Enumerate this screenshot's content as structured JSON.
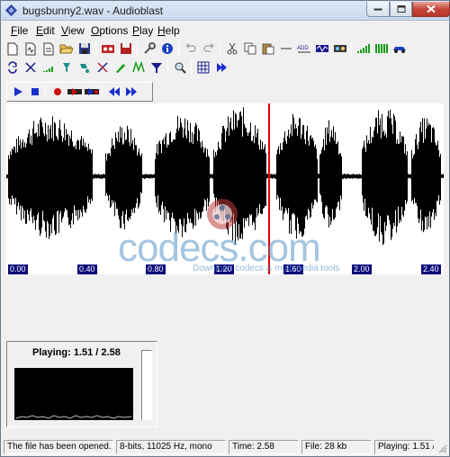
{
  "window": {
    "title": "bugsbunny2.wav - Audioblast"
  },
  "menu": {
    "items": [
      {
        "label": "File",
        "accel": "F",
        "rest": "ile"
      },
      {
        "label": "Edit",
        "accel": "E",
        "rest": "dit"
      },
      {
        "label": "View",
        "accel": "V",
        "rest": "iew"
      },
      {
        "label": "Options",
        "accel": "O",
        "rest": "ptions"
      },
      {
        "label": "Play",
        "accel": "P",
        "rest": "lay"
      },
      {
        "label": "Help",
        "accel": "H",
        "rest": "elp"
      }
    ]
  },
  "timeline": {
    "ticks": [
      "0.00",
      "0.40",
      "0.80",
      "1.20",
      "1.60",
      "2.00",
      "2.40"
    ]
  },
  "watermark": {
    "text": "codecs.com",
    "subtext": "Download codecs & multimedia tools"
  },
  "playback": {
    "label": "Playing: 1.51 / 2.58",
    "position": 1.51,
    "duration": 2.58
  },
  "status": {
    "message": "The file has been opened.",
    "format": "8-bits, 11025 Hz, mono",
    "time": "Time: 2.58",
    "file": "File: 28 kb",
    "playing": "Playing: 1.51 /"
  },
  "colors": {
    "waveform": "#000000",
    "playhead": "#e00000",
    "tick_bg": "#0a0a7a",
    "accent_blue": "#1a2ecc"
  }
}
